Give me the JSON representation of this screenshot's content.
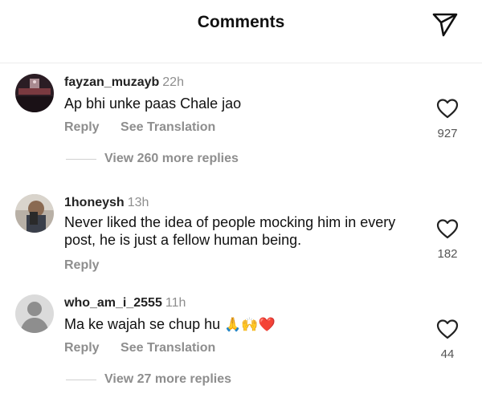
{
  "header": {
    "title": "Comments"
  },
  "comments": [
    {
      "username": "fayzan_muzayb",
      "time": "22h",
      "text": "Ap bhi unke paas Chale jao",
      "reply": "Reply",
      "translate": "See Translation",
      "likes": "927",
      "more_replies": "View 260 more replies"
    },
    {
      "username": "1honeysh",
      "time": "13h",
      "text": "Never liked the idea of people mocking him in every post, he is just a fellow human being.",
      "reply": "Reply",
      "likes": "182"
    },
    {
      "username": "who_am_i_2555",
      "time": "11h",
      "text": "Ma ke wajah se chup hu",
      "emojis": "🙏🙌❤️",
      "reply": "Reply",
      "translate": "See Translation",
      "likes": "44",
      "more_replies": "View 27 more replies"
    }
  ]
}
